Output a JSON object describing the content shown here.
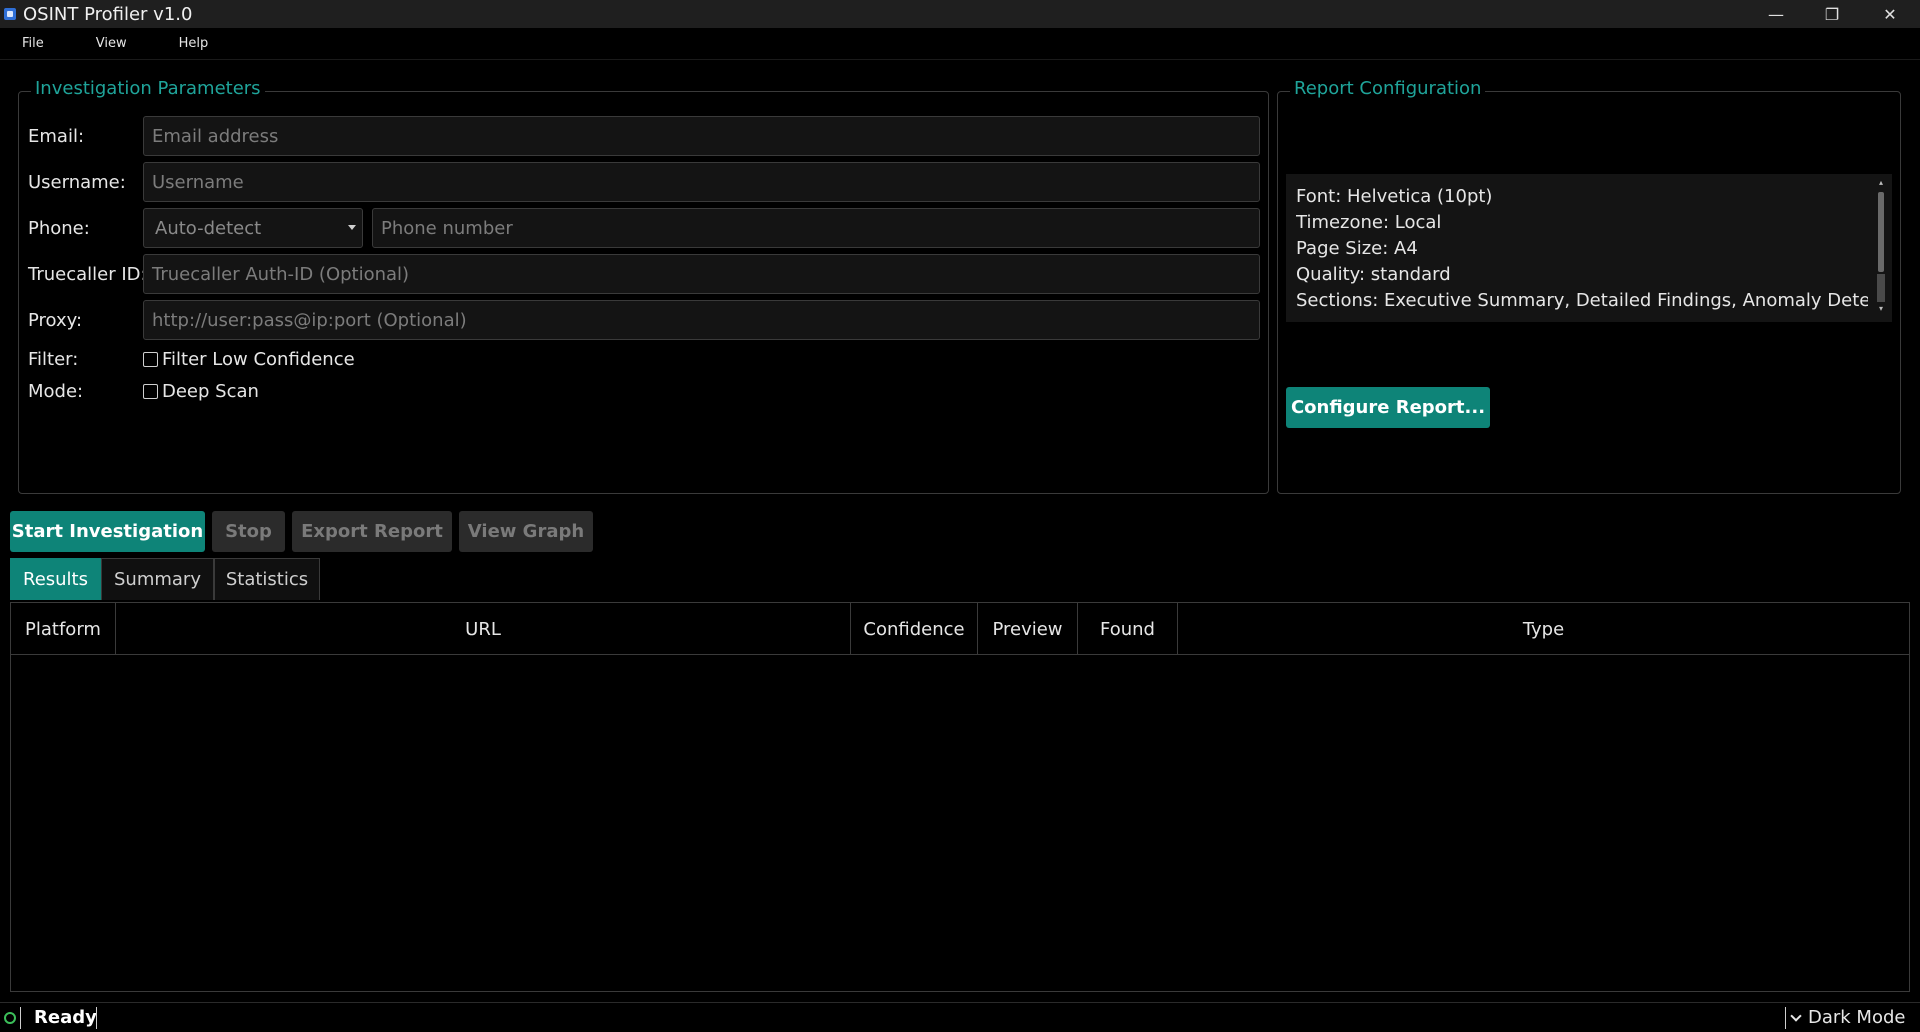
{
  "window": {
    "title": "OSINT Profiler v1.0",
    "minimize": "—",
    "maximize": "❐",
    "close": "✕"
  },
  "menu": {
    "items": [
      "File",
      "View",
      "Help"
    ]
  },
  "params": {
    "title": "Investigation Parameters",
    "email_label": "Email:",
    "email_placeholder": "Email address",
    "username_label": "Username:",
    "username_placeholder": "Username",
    "phone_label": "Phone:",
    "phone_country": "Auto-detect",
    "phone_placeholder": "Phone number",
    "truecaller_label": "Truecaller ID:",
    "truecaller_placeholder": "Truecaller Auth-ID (Optional)",
    "proxy_label": "Proxy:",
    "proxy_placeholder": "http://user:pass@ip:port (Optional)",
    "filter_label": "Filter:",
    "filter_option": "Filter Low Confidence",
    "filter_checked": false,
    "mode_label": "Mode:",
    "mode_option": "Deep Scan",
    "mode_checked": false
  },
  "report": {
    "title": "Report Configuration",
    "lines": [
      "Font: Helvetica (10pt)",
      "Timezone: Local",
      "Page Size: A4",
      "Quality: standard",
      "Sections: Executive Summary, Detailed Findings, Anomaly Detection,"
    ],
    "configure_button": "Configure Report..."
  },
  "actions": {
    "start": "Start Investigation",
    "stop": "Stop",
    "export": "Export Report",
    "graph": "View Graph"
  },
  "tabs": [
    "Results",
    "Summary",
    "Statistics"
  ],
  "active_tab": "Results",
  "table": {
    "columns": [
      "Platform",
      "URL",
      "Confidence",
      "Preview",
      "Found",
      "Type"
    ]
  },
  "status": {
    "text": "Ready",
    "theme_toggle": "Dark Mode"
  },
  "colors": {
    "accent": "#0e8478",
    "group_title": "#1fa49a",
    "status_ok": "#3cbf5a"
  }
}
